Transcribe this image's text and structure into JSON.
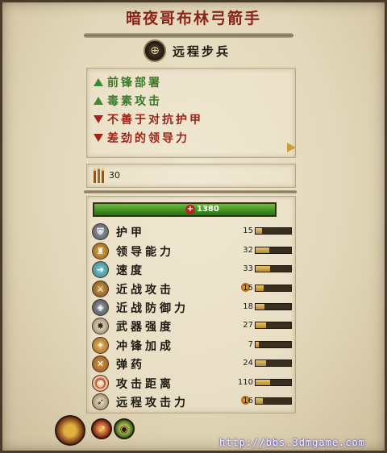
{
  "unit": {
    "name": "暗夜哥布林弓箭手",
    "type_label": "远程步兵",
    "type_icon": "ranged-infantry-emblem-icon"
  },
  "traits": [
    {
      "text": "前锋部署",
      "polarity": "positive"
    },
    {
      "text": "毒素攻击",
      "polarity": "positive"
    },
    {
      "text": "不善于对抗护甲",
      "polarity": "negative"
    },
    {
      "text": "差劲的领导力",
      "polarity": "negative"
    }
  ],
  "ammo": {
    "icon": "arrows-icon",
    "value": "30"
  },
  "health": {
    "icon": "health-cross-icon",
    "value": "1380",
    "fraction": 1.0
  },
  "stats": [
    {
      "label": "护甲",
      "icon": "armor-icon",
      "value": "15",
      "fraction": 0.18,
      "bonus": false
    },
    {
      "label": "领导能力",
      "icon": "leadership-icon",
      "value": "32",
      "fraction": 0.38,
      "bonus": false
    },
    {
      "label": "速度",
      "icon": "speed-icon",
      "value": "33",
      "fraction": 0.4,
      "bonus": false
    },
    {
      "label": "近战攻击",
      "icon": "melee-attack-icon",
      "value": "15",
      "fraction": 0.22,
      "bonus": true
    },
    {
      "label": "近战防御力",
      "icon": "melee-defence-icon",
      "value": "18",
      "fraction": 0.25,
      "bonus": false
    },
    {
      "label": "武器强度",
      "icon": "weapon-strength-icon",
      "value": "27",
      "fraction": 0.3,
      "bonus": false
    },
    {
      "label": "冲锋加成",
      "icon": "charge-bonus-icon",
      "value": "7",
      "fraction": 0.1,
      "bonus": false
    },
    {
      "label": "弹药",
      "icon": "ammunition-icon",
      "value": "24",
      "fraction": 0.3,
      "bonus": false
    },
    {
      "label": "攻击距离",
      "icon": "range-icon",
      "value": "110",
      "fraction": 0.4,
      "bonus": false
    },
    {
      "label": "远程攻击力",
      "icon": "missile-damage-icon",
      "value": "16",
      "fraction": 0.2,
      "bonus": true
    }
  ],
  "colors": {
    "positive": "#3a7a2a",
    "negative": "#9c2418",
    "title": "#8a2418",
    "bar_fill": "#d4a94a",
    "hp_fill": "#4fa82c"
  },
  "watermark": "http://bbs.3dmgame.com"
}
